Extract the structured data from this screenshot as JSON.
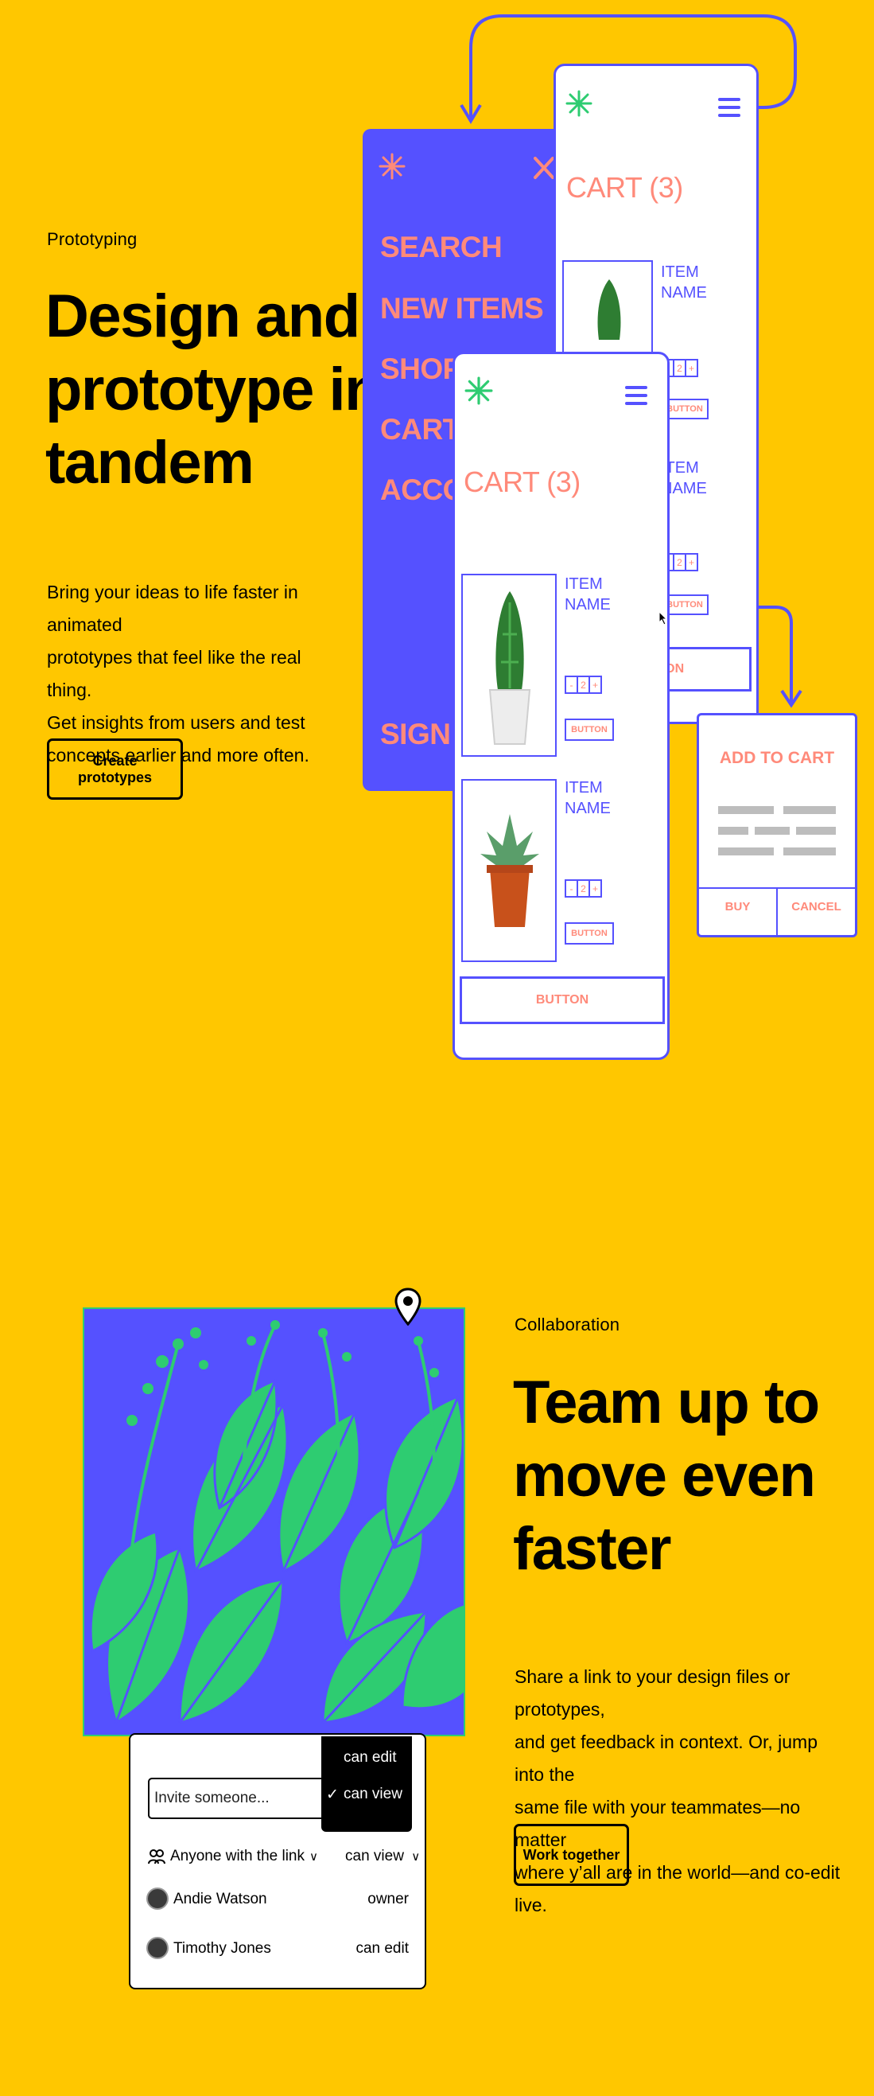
{
  "prototyping": {
    "eyebrow": "Prototyping",
    "headline_lines": [
      "Design and",
      "prototype in",
      "tandem"
    ],
    "body_lines": [
      "Bring your ideas to life faster in animated",
      "prototypes that feel like the real thing.",
      "Get insights from users and test",
      "concepts earlier and more often."
    ],
    "cta": "Create prototypes"
  },
  "mock_menu": {
    "items": [
      "SEARCH",
      "NEW ITEMS",
      "SHOP",
      "CART (3)",
      "ACCOUNT"
    ],
    "sign_out": "SIGN OUT",
    "close_icon": "close-icon"
  },
  "mock_cart_back": {
    "title": "CART (3)",
    "item_name": [
      "ITEM",
      "NAME"
    ],
    "qty": "2",
    "minus": "-",
    "plus": "+",
    "button": "BUTTON"
  },
  "mock_cart_front": {
    "title": "CART (3)",
    "items": [
      {
        "name": [
          "ITEM",
          "NAME"
        ],
        "qty": "2",
        "button": "BUTTON"
      },
      {
        "name": [
          "ITEM",
          "NAME"
        ],
        "qty": "2",
        "button": "BUTTON"
      }
    ],
    "minus": "-",
    "plus": "+",
    "main_button": "BUTTON"
  },
  "mock_dialog": {
    "title": "ADD TO CART",
    "buy": "BUY",
    "cancel": "CANCEL"
  },
  "collaboration": {
    "eyebrow": "Collaboration",
    "headline_lines": [
      "Team up to",
      "move even",
      "faster"
    ],
    "body_lines": [
      "Share a link to your design files or prototypes,",
      "and get feedback in context. Or, jump into the",
      "same file with your teammates—no matter",
      "where y’all are in the world—and co-edit live."
    ],
    "cta": "Work together"
  },
  "share_panel": {
    "invite_placeholder": "Invite someone...",
    "dropdown_options": [
      "can edit",
      "can view"
    ],
    "selected_option": "can view",
    "check": "✓",
    "link_label": "Anyone with the link",
    "link_permission": "can view",
    "chevron": "∨",
    "people": [
      {
        "name": "Andie Watson",
        "role": "owner"
      },
      {
        "name": "Timothy Jones",
        "role": "can edit"
      }
    ]
  },
  "colors": {
    "background": "#FFC700",
    "accent_blue": "#5551FF",
    "coral": "#FF8A7A",
    "leaf_green": "#2ECC71"
  }
}
